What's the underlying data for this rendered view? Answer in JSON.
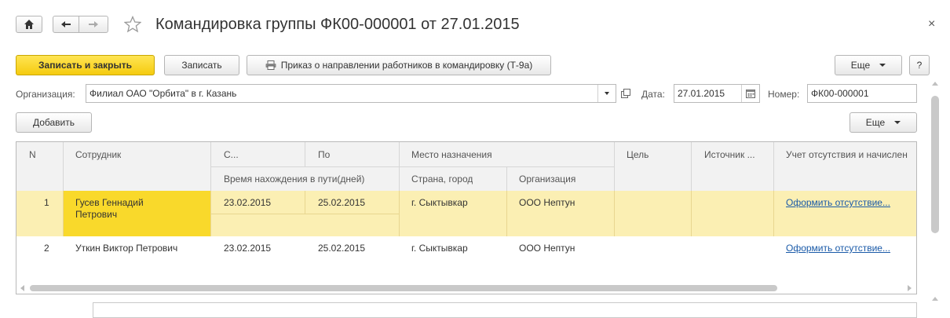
{
  "window": {
    "title": "Командировка группы ФК00-000001 от 27.01.2015",
    "close_glyph": "×"
  },
  "toolbar": {
    "save_close_label": "Записать и закрыть",
    "save_label": "Записать",
    "print_label": "Приказ о направлении работников в командировку (Т-9а)",
    "more_label": "Еще",
    "help_label": "?"
  },
  "form": {
    "org_label": "Организация:",
    "org_value": "Филиал ОАО \"Орбита\" в г. Казань",
    "date_label": "Дата:",
    "date_value": "27.01.2015",
    "number_label": "Номер:",
    "number_value": "ФК00-000001"
  },
  "table_toolbar": {
    "add_label": "Добавить",
    "more_label": "Еще"
  },
  "table": {
    "headers": {
      "n": "N",
      "employee": "Сотрудник",
      "from": "С...",
      "to": "По",
      "destination": "Место назначения",
      "purpose": "Цель",
      "source": "Источник ...",
      "absence": "Учет отсутствия и начислен",
      "travel_time": "Время нахождения в пути(дней)",
      "country_city": "Страна, город",
      "organization": "Организация"
    },
    "rows": [
      {
        "n": "1",
        "employee_line1": "Гусев Геннадий",
        "employee_line2": "Петрович",
        "from": "23.02.2015",
        "to": "25.02.2015",
        "city": "г. Сыктывкар",
        "org": "ООО Нептун",
        "absence": "Оформить отсутствие..."
      },
      {
        "n": "2",
        "employee": "Уткин Виктор Петрович",
        "from": "23.02.2015",
        "to": "25.02.2015",
        "city": "г. Сыктывкар",
        "org": "ООО Нептун",
        "absence": "Оформить отсутствие..."
      }
    ]
  },
  "colors": {
    "primary_button": "#f5cb0f",
    "selected_row": "#fbefb3",
    "selected_cell": "#f9d92b",
    "link": "#1a5aa8"
  }
}
